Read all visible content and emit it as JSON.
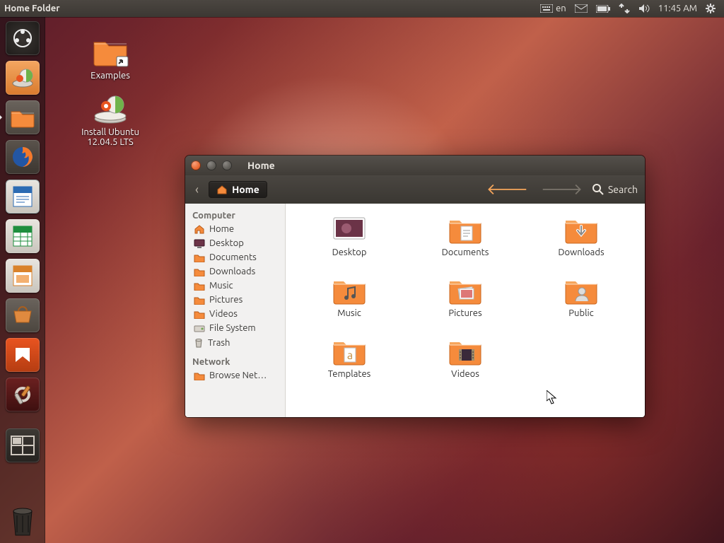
{
  "panel": {
    "app_title": "Home Folder",
    "keyboard_lang": "en",
    "clock": "11:45 AM"
  },
  "launcher": {
    "items": [
      {
        "name": "dash",
        "label": "Dash Home"
      },
      {
        "name": "disk-utility",
        "label": "Disk Utility"
      },
      {
        "name": "files",
        "label": "Home Folder",
        "active": true
      },
      {
        "name": "firefox",
        "label": "Firefox"
      },
      {
        "name": "writer",
        "label": "LibreOffice Writer"
      },
      {
        "name": "calc",
        "label": "LibreOffice Calc"
      },
      {
        "name": "impress",
        "label": "LibreOffice Impress"
      },
      {
        "name": "software-center",
        "label": "Ubuntu Software Center"
      },
      {
        "name": "ubuntu-one",
        "label": "Ubuntu One"
      },
      {
        "name": "settings",
        "label": "System Settings"
      }
    ],
    "workspace_label": "Workspace Switcher",
    "trash_label": "Trash"
  },
  "desktop": {
    "icons": [
      {
        "name": "examples",
        "label": "Examples"
      },
      {
        "name": "installer",
        "label": "Install Ubuntu 12.04.5 LTS"
      }
    ]
  },
  "filewin": {
    "title": "Home",
    "path_label": "Home",
    "search_label": "Search",
    "sidebar": {
      "computer_header": "Computer",
      "network_header": "Network",
      "computer_items": [
        {
          "name": "home",
          "label": "Home",
          "icon": "home"
        },
        {
          "name": "desktop",
          "label": "Desktop",
          "icon": "desktop"
        },
        {
          "name": "documents",
          "label": "Documents",
          "icon": "folder"
        },
        {
          "name": "downloads",
          "label": "Downloads",
          "icon": "folder"
        },
        {
          "name": "music",
          "label": "Music",
          "icon": "folder"
        },
        {
          "name": "pictures",
          "label": "Pictures",
          "icon": "folder"
        },
        {
          "name": "videos",
          "label": "Videos",
          "icon": "folder"
        },
        {
          "name": "filesystem",
          "label": "File System",
          "icon": "drive"
        },
        {
          "name": "trash",
          "label": "Trash",
          "icon": "trash"
        }
      ],
      "network_items": [
        {
          "name": "browse-network",
          "label": "Browse Net…",
          "icon": "folder"
        }
      ]
    },
    "items": [
      {
        "name": "desktop",
        "label": "Desktop",
        "icon": "desktop-thumb"
      },
      {
        "name": "documents",
        "label": "Documents",
        "icon": "folder-doc"
      },
      {
        "name": "downloads",
        "label": "Downloads",
        "icon": "folder-down"
      },
      {
        "name": "music",
        "label": "Music",
        "icon": "folder-music"
      },
      {
        "name": "pictures",
        "label": "Pictures",
        "icon": "folder-pic"
      },
      {
        "name": "public",
        "label": "Public",
        "icon": "folder-public"
      },
      {
        "name": "templates",
        "label": "Templates",
        "icon": "folder-tmpl"
      },
      {
        "name": "videos",
        "label": "Videos",
        "icon": "folder-vid"
      }
    ]
  },
  "colors": {
    "folder": "#f58b3c",
    "folder_dark": "#d96f22",
    "accent": "#e95420"
  }
}
